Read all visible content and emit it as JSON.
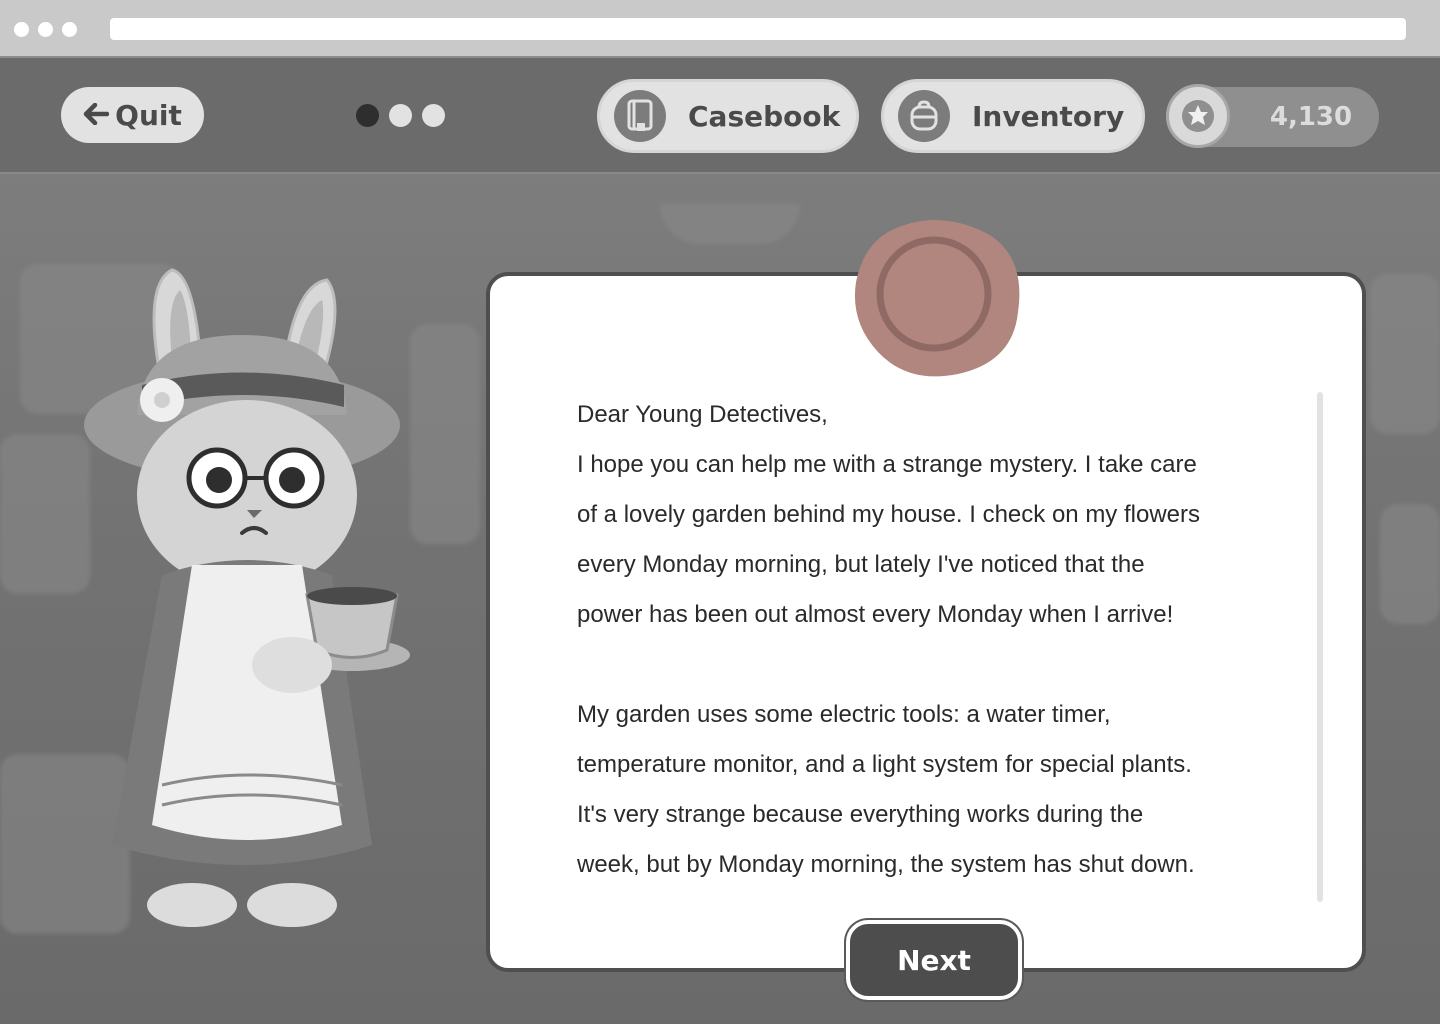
{
  "hud": {
    "quit_label": "Quit",
    "pager": {
      "total": 3,
      "active_index": 0
    },
    "casebook_label": "Casebook",
    "inventory_label": "Inventory",
    "coins_value": "4,130"
  },
  "letter": {
    "paragraphs": [
      "Dear Young Detectives,",
      "I hope you can help me with a strange mystery. I take care",
      "of a lovely garden behind my house. I check on my flowers",
      "every Monday morning, but lately I've noticed that the",
      "power has been out almost every Monday when I arrive!",
      "",
      "My garden uses some electric tools: a water timer,",
      "temperature monitor, and a light system for special plants.",
      "It's very strange because everything works during the",
      "week, but by Monday morning, the system has shut down."
    ]
  },
  "next_label": "Next",
  "icons": {
    "back": "arrow-left-icon",
    "casebook": "book-icon",
    "inventory": "backpack-icon",
    "coins": "star-flower-icon",
    "seal": "wax-seal-icon"
  },
  "colors": {
    "seal": "#b0867f",
    "next_bg": "#4d4d4d",
    "active_dot": "#2e2e2e"
  }
}
